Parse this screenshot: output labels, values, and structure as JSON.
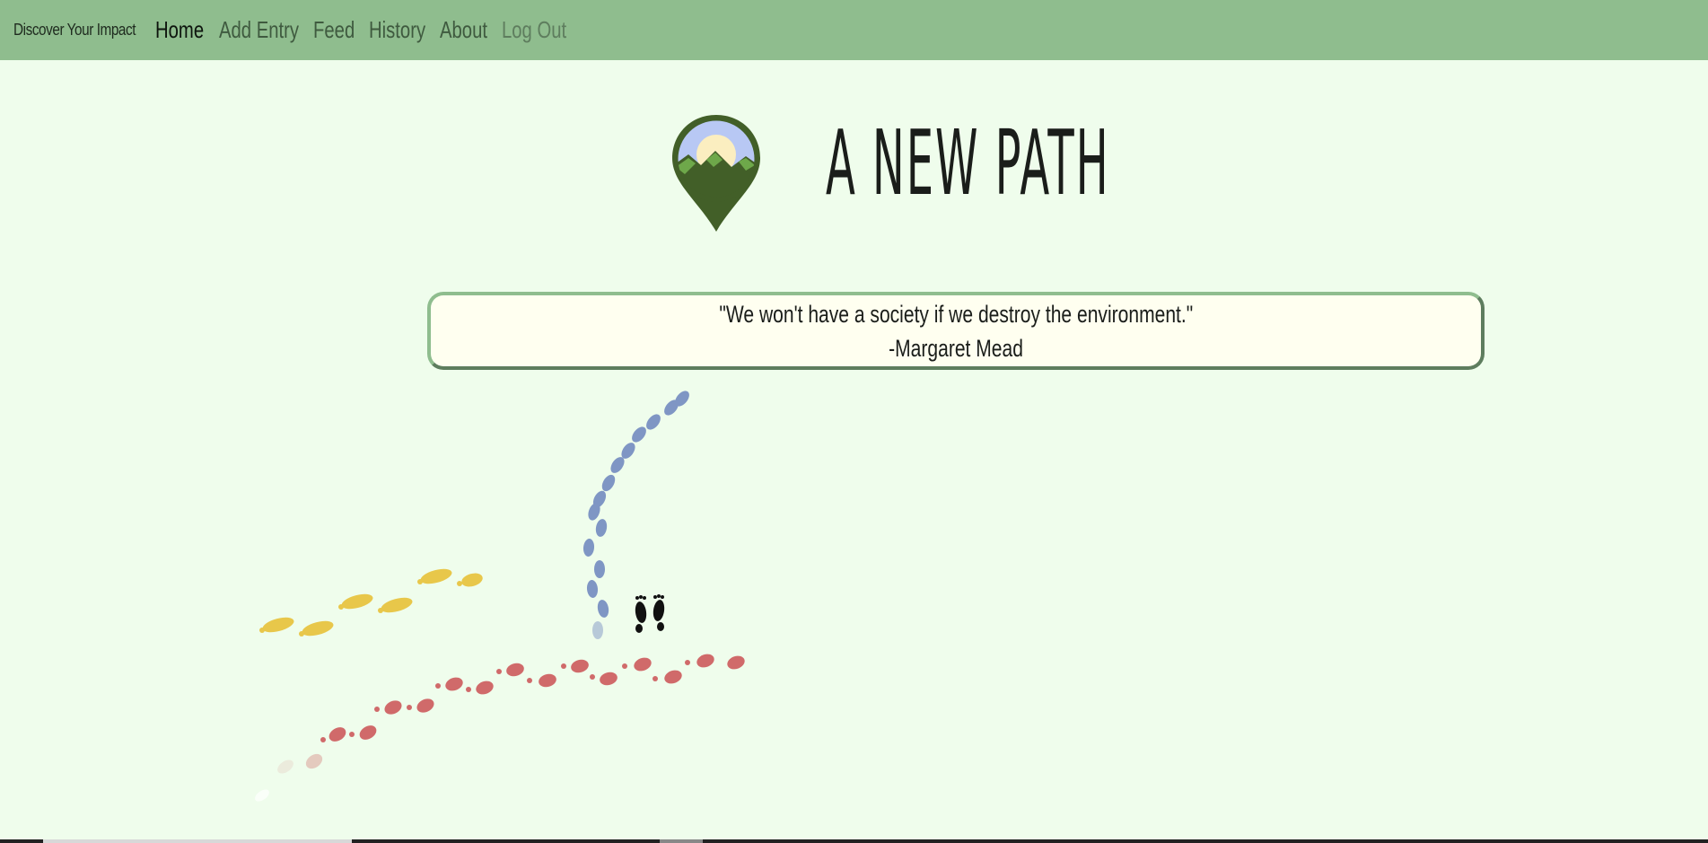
{
  "nav": {
    "brand": "Discover Your Impact",
    "links": [
      {
        "label": "Home",
        "state": "active"
      },
      {
        "label": "Add Entry",
        "state": "normal"
      },
      {
        "label": "Feed",
        "state": "normal"
      },
      {
        "label": "History",
        "state": "normal"
      },
      {
        "label": "About",
        "state": "normal"
      },
      {
        "label": "Log Out",
        "state": "muted"
      }
    ]
  },
  "hero": {
    "title": "A NEW PATH",
    "logo_icon": "map-pin-mountain-icon"
  },
  "quote": {
    "text": "\"We won't have a society if we destroy the environment.\"",
    "author": "-Margaret Mead"
  },
  "decor": {
    "footprints_icon": "footprints-icon",
    "colors": {
      "blue_trail": "#7f96c4",
      "yellow_trail": "#e8c74a",
      "red_trail": "#d06a6a",
      "navbar": "#8fbd8e",
      "background": "#effdec"
    }
  }
}
